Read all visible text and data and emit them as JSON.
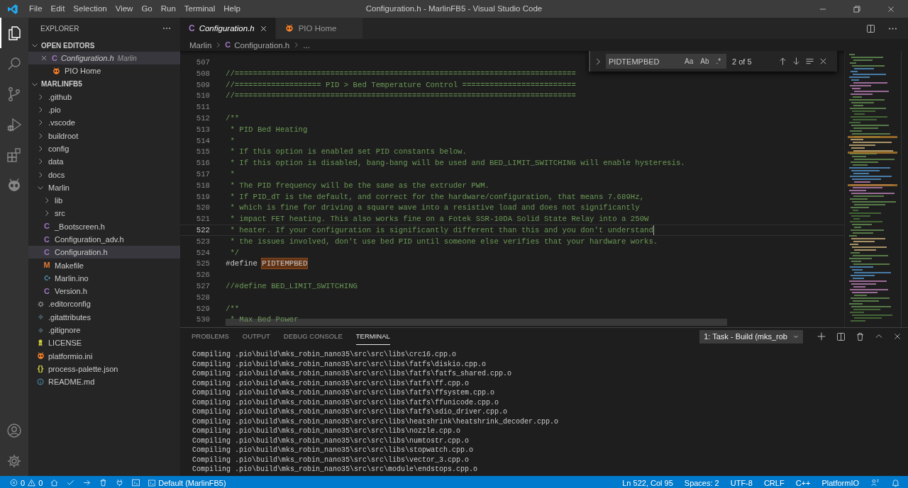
{
  "title_bar": {
    "menus": [
      "File",
      "Edit",
      "Selection",
      "View",
      "Go",
      "Run",
      "Terminal",
      "Help"
    ],
    "title": "Configuration.h - MarlinFB5 - Visual Studio Code"
  },
  "activity_bar": {
    "items": [
      {
        "kind": "explorer",
        "selected": true
      },
      {
        "kind": "search",
        "selected": false
      },
      {
        "kind": "scm",
        "selected": false
      },
      {
        "kind": "debug",
        "selected": false
      },
      {
        "kind": "extensions",
        "selected": false
      },
      {
        "kind": "platformio",
        "selected": false
      }
    ],
    "bottom": [
      {
        "kind": "account"
      },
      {
        "kind": "settings"
      }
    ]
  },
  "sidebar": {
    "title": "EXPLORER",
    "open_editors": {
      "title": "OPEN EDITORS",
      "expanded": true,
      "items": [
        {
          "label": "Configuration.h",
          "description": "Marlin",
          "kind": "c",
          "glyph": "C",
          "italic": true,
          "selected": true
        },
        {
          "label": "PIO Home",
          "kind": "pio",
          "italic": false,
          "selected": false
        }
      ]
    },
    "folder": {
      "title": "MARLINFB5",
      "expanded": true,
      "tree": [
        {
          "label": ".github",
          "kind": "folder",
          "expanded": false,
          "selected": false
        },
        {
          "label": ".pio",
          "kind": "folder",
          "expanded": false,
          "selected": false
        },
        {
          "label": ".vscode",
          "kind": "folder",
          "expanded": false,
          "selected": false
        },
        {
          "label": "buildroot",
          "kind": "folder",
          "expanded": false,
          "selected": false
        },
        {
          "label": "config",
          "kind": "folder",
          "expanded": false,
          "selected": false
        },
        {
          "label": "data",
          "kind": "folder",
          "expanded": false,
          "selected": false
        },
        {
          "label": "docs",
          "kind": "folder",
          "expanded": false,
          "selected": false
        },
        {
          "label": "Marlin",
          "kind": "folder",
          "expanded": true,
          "selected": false,
          "children": [
            {
              "label": "lib",
              "kind": "folder",
              "expanded": false,
              "selected": false
            },
            {
              "label": "src",
              "kind": "folder",
              "expanded": false,
              "selected": false
            },
            {
              "label": "_Bootscreen.h",
              "kind": "c",
              "glyph": "C",
              "selected": false
            },
            {
              "label": "Configuration_adv.h",
              "kind": "c",
              "glyph": "C",
              "selected": false
            },
            {
              "label": "Configuration.h",
              "kind": "c",
              "glyph": "C",
              "selected": true
            },
            {
              "label": "Makefile",
              "kind": "make",
              "glyph": "M",
              "selected": false
            },
            {
              "label": "Marlin.ino",
              "kind": "ino",
              "selected": false
            },
            {
              "label": "Version.h",
              "kind": "c",
              "glyph": "C",
              "selected": false
            }
          ]
        },
        {
          "label": ".editorconfig",
          "kind": "config",
          "selected": false
        },
        {
          "label": ".gitattributes",
          "kind": "git",
          "selected": false
        },
        {
          "label": ".gitignore",
          "kind": "git",
          "selected": false
        },
        {
          "label": "LICENSE",
          "kind": "license",
          "selected": false
        },
        {
          "label": "platformio.ini",
          "kind": "pio",
          "selected": false
        },
        {
          "label": "process-palette.json",
          "kind": "json",
          "glyph": "{}",
          "selected": false
        },
        {
          "label": "README.md",
          "kind": "info",
          "selected": false
        }
      ]
    }
  },
  "editor": {
    "tabs": [
      {
        "label": "Configuration.h",
        "kind": "c",
        "glyph": "C",
        "italic": true,
        "selected": true
      },
      {
        "label": "PIO Home",
        "kind": "pio",
        "italic": false,
        "selected": false
      }
    ],
    "breadcrumb": [
      {
        "label": "Marlin"
      },
      {
        "label": "Configuration.h",
        "kind": "c",
        "glyph": "C"
      },
      {
        "label": "..."
      }
    ],
    "find": {
      "value": "PIDTEMPBED",
      "options": [
        {
          "label": "Aa",
          "on": false
        },
        {
          "label": "Ab",
          "on": false
        },
        {
          "label": ".*",
          "on": false
        }
      ],
      "count": "2 of 5"
    },
    "lines": [
      {
        "number": "507",
        "current": false
      },
      {
        "number": "508",
        "current": false,
        "parts": [
          {
            "kind": "comment",
            "text": "//==========================================================================="
          }
        ]
      },
      {
        "number": "509",
        "current": false,
        "parts": [
          {
            "kind": "comment",
            "text": "//=================== PID > Bed Temperature Control ========================="
          }
        ]
      },
      {
        "number": "510",
        "current": false,
        "parts": [
          {
            "kind": "comment",
            "text": "//==========================================================================="
          }
        ]
      },
      {
        "number": "511",
        "current": false
      },
      {
        "number": "512",
        "current": false,
        "parts": [
          {
            "kind": "comment",
            "text": "/**"
          }
        ]
      },
      {
        "number": "513",
        "current": false,
        "parts": [
          {
            "kind": "comment",
            "text": " * PID Bed Heating"
          }
        ]
      },
      {
        "number": "514",
        "current": false,
        "parts": [
          {
            "kind": "comment",
            "text": " *"
          }
        ]
      },
      {
        "number": "515",
        "current": false,
        "parts": [
          {
            "kind": "comment",
            "text": " * If this option is enabled set PID constants below."
          }
        ]
      },
      {
        "number": "516",
        "current": false,
        "parts": [
          {
            "kind": "comment",
            "text": " * If this option is disabled, bang-bang will be used and BED_LIMIT_SWITCHING will enable hysteresis."
          }
        ]
      },
      {
        "number": "517",
        "current": false,
        "parts": [
          {
            "kind": "comment",
            "text": " *"
          }
        ]
      },
      {
        "number": "518",
        "current": false,
        "parts": [
          {
            "kind": "comment",
            "text": " * The PID frequency will be the same as the extruder PWM."
          }
        ]
      },
      {
        "number": "519",
        "current": false,
        "parts": [
          {
            "kind": "comment",
            "text": " * If PID_dT is the default, and correct for the hardware/configuration, that means 7.689Hz,"
          }
        ]
      },
      {
        "number": "520",
        "current": false,
        "parts": [
          {
            "kind": "comment",
            "text": " * which is fine for driving a square wave into a resistive load and does not significantly"
          }
        ]
      },
      {
        "number": "521",
        "current": false,
        "parts": [
          {
            "kind": "comment",
            "text": " * impact FET heating. This also works fine on a Fotek SSR-10DA Solid State Relay into a 250W"
          }
        ]
      },
      {
        "number": "522",
        "current": true,
        "parts": [
          {
            "kind": "comment",
            "text": " * heater. If your configuration is significantly different than this and you don't understand"
          }
        ]
      },
      {
        "number": "523",
        "current": false,
        "parts": [
          {
            "kind": "comment",
            "text": " * the issues involved, don't use bed PID until someone else verifies that your hardware works."
          }
        ]
      },
      {
        "number": "524",
        "current": false,
        "parts": [
          {
            "kind": "comment",
            "text": " */"
          }
        ]
      },
      {
        "number": "525",
        "current": false,
        "parts": [
          {
            "kind": "directive",
            "text": "#define "
          },
          {
            "kind": "match",
            "text": "PIDTEMPBED"
          }
        ]
      },
      {
        "number": "526",
        "current": false
      },
      {
        "number": "527",
        "current": false,
        "parts": [
          {
            "kind": "comment",
            "text": "//#define BED_LIMIT_SWITCHING"
          }
        ]
      },
      {
        "number": "528",
        "current": false
      },
      {
        "number": "529",
        "current": false,
        "parts": [
          {
            "kind": "comment",
            "text": "/**"
          }
        ]
      },
      {
        "number": "530",
        "current": false,
        "parts": [
          {
            "kind": "comment",
            "text": " * Max Bed Power"
          }
        ]
      }
    ]
  },
  "panel": {
    "tabs": [
      {
        "label": "PROBLEMS",
        "selected": false
      },
      {
        "label": "OUTPUT",
        "selected": false
      },
      {
        "label": "DEBUG CONSOLE",
        "selected": false
      },
      {
        "label": "TERMINAL",
        "selected": true
      }
    ],
    "terminal_select": "1: Task - Build (mks_rob",
    "lines": [
      "Compiling .pio\\build\\mks_robin_nano35\\src\\src\\libs\\crc16.cpp.o",
      "Compiling .pio\\build\\mks_robin_nano35\\src\\src\\libs\\fatfs\\diskio.cpp.o",
      "Compiling .pio\\build\\mks_robin_nano35\\src\\src\\libs\\fatfs\\fatfs_shared.cpp.o",
      "Compiling .pio\\build\\mks_robin_nano35\\src\\src\\libs\\fatfs\\ff.cpp.o",
      "Compiling .pio\\build\\mks_robin_nano35\\src\\src\\libs\\fatfs\\ffsystem.cpp.o",
      "Compiling .pio\\build\\mks_robin_nano35\\src\\src\\libs\\fatfs\\ffunicode.cpp.o",
      "Compiling .pio\\build\\mks_robin_nano35\\src\\src\\libs\\fatfs\\sdio_driver.cpp.o",
      "Compiling .pio\\build\\mks_robin_nano35\\src\\src\\libs\\heatshrink\\heatshrink_decoder.cpp.o",
      "Compiling .pio\\build\\mks_robin_nano35\\src\\src\\libs\\nozzle.cpp.o",
      "Compiling .pio\\build\\mks_robin_nano35\\src\\src\\libs\\numtostr.cpp.o",
      "Compiling .pio\\build\\mks_robin_nano35\\src\\src\\libs\\stopwatch.cpp.o",
      "Compiling .pio\\build\\mks_robin_nano35\\src\\src\\libs\\vector_3.cpp.o",
      "Compiling .pio\\build\\mks_robin_nano35\\src\\src\\module\\endstops.cpp.o"
    ]
  },
  "status_bar": {
    "errors": "0",
    "warnings": "0",
    "terminal_profile": "Default (MarlinFB5)",
    "items": [
      "Ln 522, Col 95",
      "Spaces: 2",
      "UTF-8",
      "CRLF",
      "C++",
      "PlatformIO"
    ]
  }
}
